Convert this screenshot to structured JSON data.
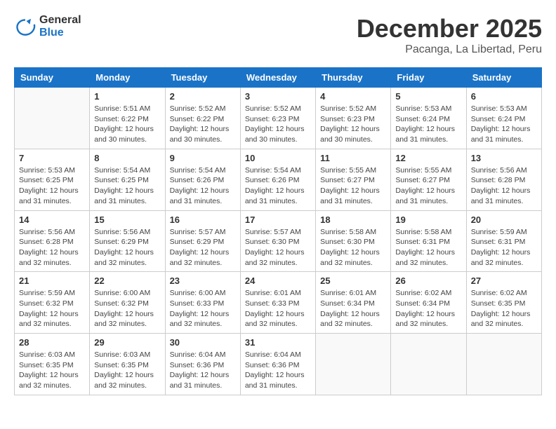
{
  "logo": {
    "line1": "General",
    "line2": "Blue"
  },
  "title": "December 2025",
  "subtitle": "Pacanga, La Libertad, Peru",
  "weekdays": [
    "Sunday",
    "Monday",
    "Tuesday",
    "Wednesday",
    "Thursday",
    "Friday",
    "Saturday"
  ],
  "weeks": [
    [
      {
        "day": "",
        "sunrise": "",
        "sunset": "",
        "daylight": ""
      },
      {
        "day": "1",
        "sunrise": "Sunrise: 5:51 AM",
        "sunset": "Sunset: 6:22 PM",
        "daylight": "Daylight: 12 hours and 30 minutes."
      },
      {
        "day": "2",
        "sunrise": "Sunrise: 5:52 AM",
        "sunset": "Sunset: 6:22 PM",
        "daylight": "Daylight: 12 hours and 30 minutes."
      },
      {
        "day": "3",
        "sunrise": "Sunrise: 5:52 AM",
        "sunset": "Sunset: 6:23 PM",
        "daylight": "Daylight: 12 hours and 30 minutes."
      },
      {
        "day": "4",
        "sunrise": "Sunrise: 5:52 AM",
        "sunset": "Sunset: 6:23 PM",
        "daylight": "Daylight: 12 hours and 30 minutes."
      },
      {
        "day": "5",
        "sunrise": "Sunrise: 5:53 AM",
        "sunset": "Sunset: 6:24 PM",
        "daylight": "Daylight: 12 hours and 31 minutes."
      },
      {
        "day": "6",
        "sunrise": "Sunrise: 5:53 AM",
        "sunset": "Sunset: 6:24 PM",
        "daylight": "Daylight: 12 hours and 31 minutes."
      }
    ],
    [
      {
        "day": "7",
        "sunrise": "Sunrise: 5:53 AM",
        "sunset": "Sunset: 6:25 PM",
        "daylight": "Daylight: 12 hours and 31 minutes."
      },
      {
        "day": "8",
        "sunrise": "Sunrise: 5:54 AM",
        "sunset": "Sunset: 6:25 PM",
        "daylight": "Daylight: 12 hours and 31 minutes."
      },
      {
        "day": "9",
        "sunrise": "Sunrise: 5:54 AM",
        "sunset": "Sunset: 6:26 PM",
        "daylight": "Daylight: 12 hours and 31 minutes."
      },
      {
        "day": "10",
        "sunrise": "Sunrise: 5:54 AM",
        "sunset": "Sunset: 6:26 PM",
        "daylight": "Daylight: 12 hours and 31 minutes."
      },
      {
        "day": "11",
        "sunrise": "Sunrise: 5:55 AM",
        "sunset": "Sunset: 6:27 PM",
        "daylight": "Daylight: 12 hours and 31 minutes."
      },
      {
        "day": "12",
        "sunrise": "Sunrise: 5:55 AM",
        "sunset": "Sunset: 6:27 PM",
        "daylight": "Daylight: 12 hours and 31 minutes."
      },
      {
        "day": "13",
        "sunrise": "Sunrise: 5:56 AM",
        "sunset": "Sunset: 6:28 PM",
        "daylight": "Daylight: 12 hours and 31 minutes."
      }
    ],
    [
      {
        "day": "14",
        "sunrise": "Sunrise: 5:56 AM",
        "sunset": "Sunset: 6:28 PM",
        "daylight": "Daylight: 12 hours and 32 minutes."
      },
      {
        "day": "15",
        "sunrise": "Sunrise: 5:56 AM",
        "sunset": "Sunset: 6:29 PM",
        "daylight": "Daylight: 12 hours and 32 minutes."
      },
      {
        "day": "16",
        "sunrise": "Sunrise: 5:57 AM",
        "sunset": "Sunset: 6:29 PM",
        "daylight": "Daylight: 12 hours and 32 minutes."
      },
      {
        "day": "17",
        "sunrise": "Sunrise: 5:57 AM",
        "sunset": "Sunset: 6:30 PM",
        "daylight": "Daylight: 12 hours and 32 minutes."
      },
      {
        "day": "18",
        "sunrise": "Sunrise: 5:58 AM",
        "sunset": "Sunset: 6:30 PM",
        "daylight": "Daylight: 12 hours and 32 minutes."
      },
      {
        "day": "19",
        "sunrise": "Sunrise: 5:58 AM",
        "sunset": "Sunset: 6:31 PM",
        "daylight": "Daylight: 12 hours and 32 minutes."
      },
      {
        "day": "20",
        "sunrise": "Sunrise: 5:59 AM",
        "sunset": "Sunset: 6:31 PM",
        "daylight": "Daylight: 12 hours and 32 minutes."
      }
    ],
    [
      {
        "day": "21",
        "sunrise": "Sunrise: 5:59 AM",
        "sunset": "Sunset: 6:32 PM",
        "daylight": "Daylight: 12 hours and 32 minutes."
      },
      {
        "day": "22",
        "sunrise": "Sunrise: 6:00 AM",
        "sunset": "Sunset: 6:32 PM",
        "daylight": "Daylight: 12 hours and 32 minutes."
      },
      {
        "day": "23",
        "sunrise": "Sunrise: 6:00 AM",
        "sunset": "Sunset: 6:33 PM",
        "daylight": "Daylight: 12 hours and 32 minutes."
      },
      {
        "day": "24",
        "sunrise": "Sunrise: 6:01 AM",
        "sunset": "Sunset: 6:33 PM",
        "daylight": "Daylight: 12 hours and 32 minutes."
      },
      {
        "day": "25",
        "sunrise": "Sunrise: 6:01 AM",
        "sunset": "Sunset: 6:34 PM",
        "daylight": "Daylight: 12 hours and 32 minutes."
      },
      {
        "day": "26",
        "sunrise": "Sunrise: 6:02 AM",
        "sunset": "Sunset: 6:34 PM",
        "daylight": "Daylight: 12 hours and 32 minutes."
      },
      {
        "day": "27",
        "sunrise": "Sunrise: 6:02 AM",
        "sunset": "Sunset: 6:35 PM",
        "daylight": "Daylight: 12 hours and 32 minutes."
      }
    ],
    [
      {
        "day": "28",
        "sunrise": "Sunrise: 6:03 AM",
        "sunset": "Sunset: 6:35 PM",
        "daylight": "Daylight: 12 hours and 32 minutes."
      },
      {
        "day": "29",
        "sunrise": "Sunrise: 6:03 AM",
        "sunset": "Sunset: 6:35 PM",
        "daylight": "Daylight: 12 hours and 32 minutes."
      },
      {
        "day": "30",
        "sunrise": "Sunrise: 6:04 AM",
        "sunset": "Sunset: 6:36 PM",
        "daylight": "Daylight: 12 hours and 31 minutes."
      },
      {
        "day": "31",
        "sunrise": "Sunrise: 6:04 AM",
        "sunset": "Sunset: 6:36 PM",
        "daylight": "Daylight: 12 hours and 31 minutes."
      },
      {
        "day": "",
        "sunrise": "",
        "sunset": "",
        "daylight": ""
      },
      {
        "day": "",
        "sunrise": "",
        "sunset": "",
        "daylight": ""
      },
      {
        "day": "",
        "sunrise": "",
        "sunset": "",
        "daylight": ""
      }
    ]
  ]
}
